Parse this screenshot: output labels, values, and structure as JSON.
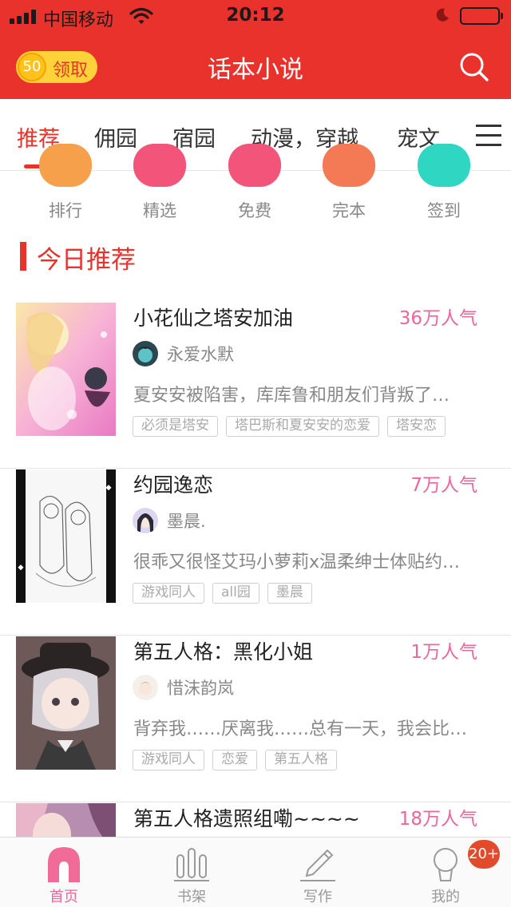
{
  "status_bar": {
    "carrier": "中国移动",
    "time": "20:12",
    "battery_level": 0.06
  },
  "header": {
    "coin_value": "50",
    "coin_label": "领取",
    "title": "话本小说",
    "accent_color": "#e8322b"
  },
  "tabs": [
    {
      "label": "推荐"
    },
    {
      "label": "佣园"
    },
    {
      "label": "宿园"
    },
    {
      "label": "动漫，穿越"
    },
    {
      "label": "宠文"
    }
  ],
  "shortcuts": [
    {
      "label": "排行",
      "color": "#f6a04c"
    },
    {
      "label": "精选",
      "color": "#f2547a"
    },
    {
      "label": "免费",
      "color": "#f2547a"
    },
    {
      "label": "完本",
      "color": "#f47a56"
    },
    {
      "label": "签到",
      "color": "#2fd6c2"
    }
  ],
  "section": {
    "title": "今日推荐"
  },
  "books": [
    {
      "title": "小花仙之塔安加油",
      "popularity": "36万人气",
      "author": "永爱水默",
      "description": "夏安安被陷害，库库鲁和朋友们背叛了…",
      "tags": [
        "必须是塔安",
        "塔巴斯和夏安安的恋爱",
        "塔安恋"
      ]
    },
    {
      "title": "约园逸恋",
      "popularity": "7万人气",
      "author": "墨晨.",
      "description": "很乖又很怪艾玛小萝莉x温柔绅士体贴约…",
      "tags": [
        "游戏同人",
        "all园",
        "墨晨"
      ]
    },
    {
      "title": "第五人格：黑化小姐",
      "popularity": "1万人气",
      "author": "惜沫韵岚",
      "description": "背弃我……厌离我……总有一天，我会比…",
      "tags": [
        "游戏同人",
        "恋爱",
        "第五人格"
      ]
    },
    {
      "title": "第五人格遗照组嘞~~~~",
      "popularity": "18万人气"
    }
  ],
  "bottom_nav": {
    "items": [
      {
        "label": "首页"
      },
      {
        "label": "书架"
      },
      {
        "label": "写作"
      },
      {
        "label": "我的"
      }
    ],
    "badge": "20+"
  }
}
